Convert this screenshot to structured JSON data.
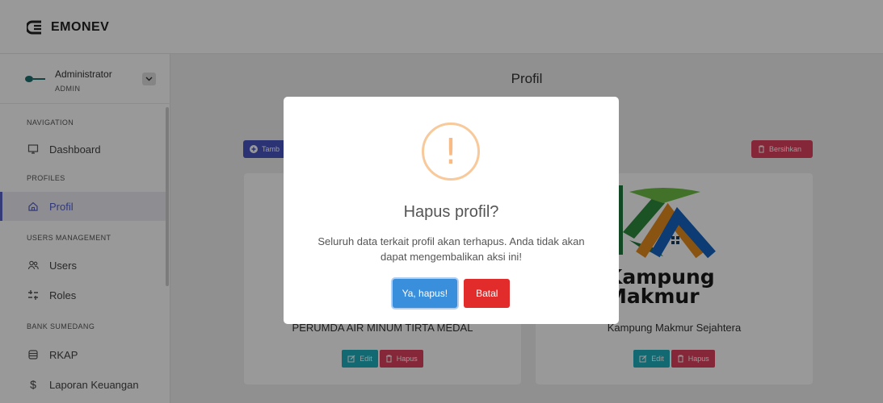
{
  "app": {
    "brand": "EMONEV"
  },
  "user": {
    "name": "Administrator",
    "role": "ADMIN"
  },
  "sidebar": {
    "sections": [
      {
        "title": "NAVIGATION",
        "items": [
          {
            "label": "Dashboard",
            "icon": "monitor-icon"
          }
        ]
      },
      {
        "title": "PROFILES",
        "items": [
          {
            "label": "Profil",
            "icon": "home-icon",
            "active": true
          }
        ]
      },
      {
        "title": "USERS MANAGEMENT",
        "items": [
          {
            "label": "Users",
            "icon": "users-icon"
          },
          {
            "label": "Roles",
            "icon": "roles-icon"
          }
        ]
      },
      {
        "title": "BANK SUMEDANG",
        "items": [
          {
            "label": "RKAP",
            "icon": "database-icon"
          },
          {
            "label": "Laporan Keuangan",
            "icon": "dollar-icon"
          }
        ]
      }
    ]
  },
  "main": {
    "title": "Profil",
    "add_label": "Tamb",
    "clear_label": "Bersihkan",
    "cards": [
      {
        "name": "PERUMDA AIR MINUM TIRTA MEDAL",
        "edit_label": "Edit",
        "delete_label": "Hapus"
      },
      {
        "name": "Kampung Makmur Sejahtera",
        "edit_label": "Edit",
        "delete_label": "Hapus",
        "logo_text_1": "Kampung",
        "logo_text_2": "Makmur"
      }
    ]
  },
  "modal": {
    "title": "Hapus profil?",
    "text": "Seluruh data terkait profil akan terhapus. Anda tidak akan dapat mengembalikan aksi ini!",
    "confirm_label": "Ya, hapus!",
    "cancel_label": "Batal"
  },
  "colors": {
    "accent": "#4a55c4",
    "danger": "#e0425f",
    "info": "#1fb0bf",
    "confirm": "#3a8fdc",
    "cancel": "#e22c2c",
    "warning": "#f8bb86"
  }
}
